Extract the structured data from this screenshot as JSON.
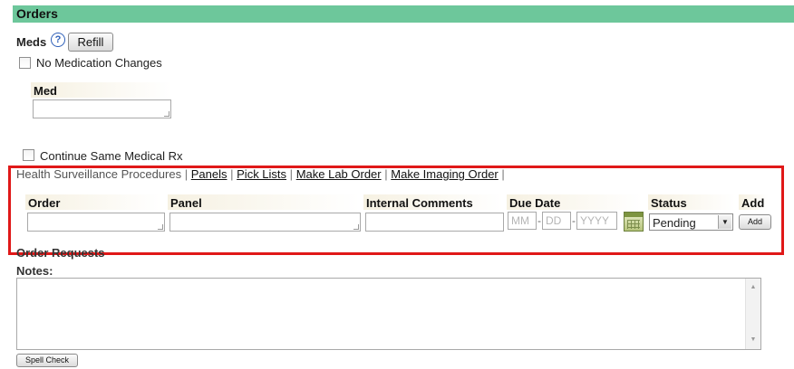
{
  "header": {
    "title": "Orders"
  },
  "meds": {
    "label": "Meds",
    "help_icon": "?",
    "refill_label": "Refill",
    "no_med_changes_label": "No Medication Changes",
    "med_column": "Med",
    "continue_rx_label": "Continue Same Medical Rx"
  },
  "links_bar": {
    "prefix": "Health Surveillance Procedures",
    "links": [
      "Panels",
      "Pick Lists",
      "Make Lab Order",
      "Make Imaging Order"
    ],
    "separator": "|"
  },
  "order_table": {
    "columns": {
      "order": "Order",
      "panel": "Panel",
      "internal_comments": "Internal Comments",
      "due_date": "Due Date",
      "status": "Status",
      "add": "Add"
    },
    "date_placeholders": {
      "month": "MM",
      "day": "DD",
      "year": "YYYY"
    },
    "date_sep": "-",
    "status_value": "Pending",
    "add_button_label": "Add"
  },
  "order_requests": {
    "title": "Order Requests",
    "notes_label": "Notes:",
    "spell_check_label": "Spell Check"
  },
  "icons": {
    "help": "question-circle-icon",
    "calendar": "calendar-icon",
    "dropdown": "chevron-down-icon"
  },
  "colors": {
    "header_bg": "#6dc79b",
    "highlight_border": "#e01818",
    "help_icon": "#2e5fb8"
  }
}
